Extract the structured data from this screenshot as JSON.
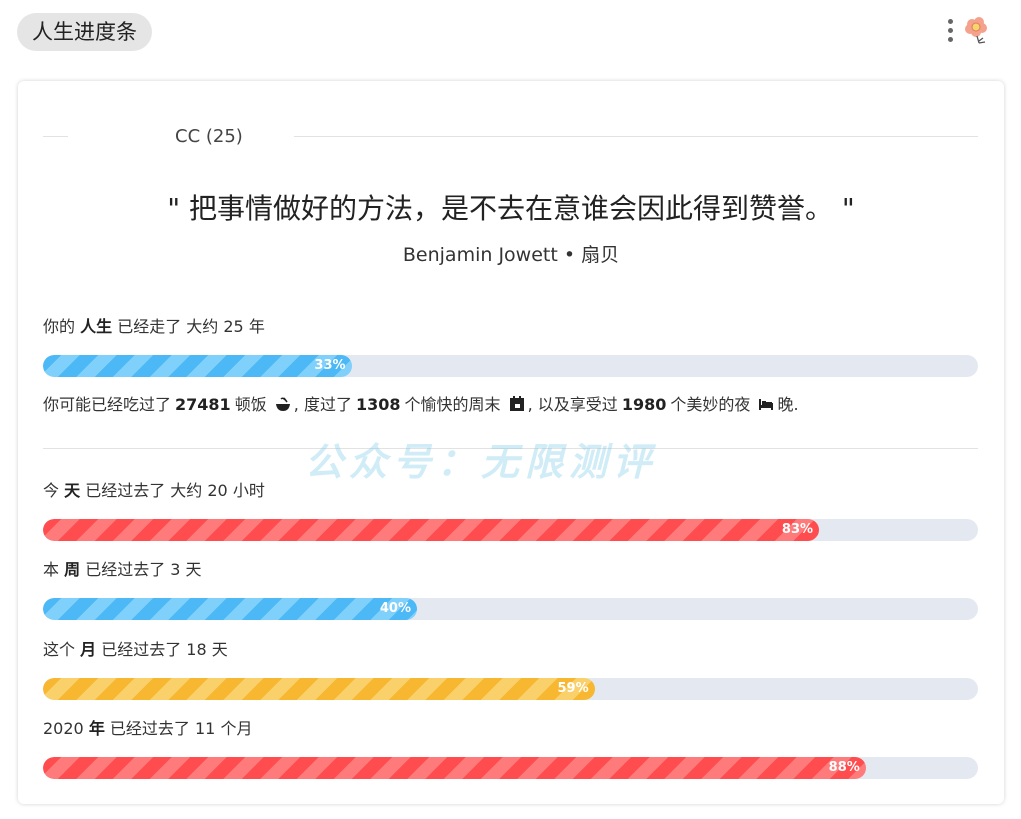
{
  "app": {
    "title": "人生进度条"
  },
  "card": {
    "author": "CC (25)",
    "quote": "\" 把事情做好的方法，是不去在意谁会因此得到赞誉。 \"",
    "quote_source": "Benjamin Jowett • 扇贝",
    "life": {
      "prefix": "你的 ",
      "bold": "人生",
      "suffix": " 已经走了 大约 25 年",
      "percent_label": "33%",
      "percent": 33,
      "color_a": "#4cb8f5",
      "color_b": "#7fd0fa"
    },
    "stats": {
      "t1": "你可能已经吃过了",
      "meals": "27481",
      "t2": "顿饭",
      "t3": ", 度过了",
      "weekends": "1308",
      "t4": "个愉快的周末",
      "t5": ", 以及享受过",
      "nights": "1980",
      "t6": "个美妙的夜",
      "t7": "晚."
    },
    "day": {
      "prefix": "今 ",
      "bold": "天",
      "suffix": " 已经过去了 大约 20 小时",
      "percent_label": "83%",
      "percent": 83,
      "color_a": "#ff4d4f",
      "color_b": "#ff7a7a"
    },
    "week": {
      "prefix": "本 ",
      "bold": "周",
      "suffix": " 已经过去了 3 天",
      "percent_label": "40%",
      "percent": 40,
      "color_a": "#4cb8f5",
      "color_b": "#7fd0fa"
    },
    "month": {
      "prefix": "这个 ",
      "bold": "月",
      "suffix": " 已经过去了 18 天",
      "percent_label": "59%",
      "percent": 59,
      "color_a": "#f7b731",
      "color_b": "#fad06b"
    },
    "year": {
      "prefix": "2020 ",
      "bold": "年",
      "suffix": " 已经过去了 11 个月",
      "percent_label": "88%",
      "percent": 88,
      "color_a": "#ff4d4f",
      "color_b": "#ff7a7a"
    }
  },
  "watermark": "公众号：无限测评",
  "icons": {
    "menu": "more-vertical-icon",
    "avatar": "flower-avatar-icon",
    "meal": "bowl-icon",
    "weekend": "calendar-icon",
    "night": "bed-icon"
  }
}
